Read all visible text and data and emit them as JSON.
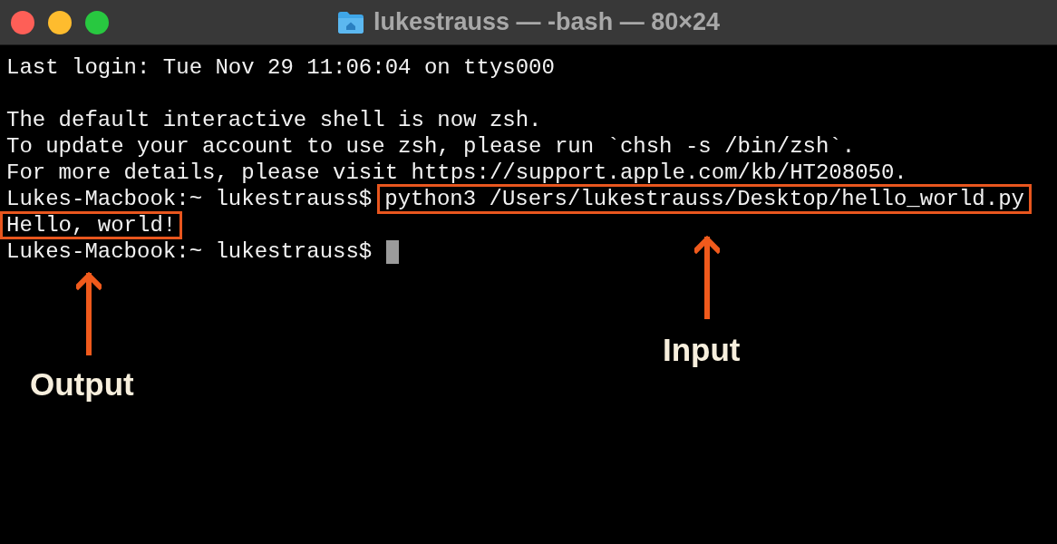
{
  "window": {
    "title": "lukestrauss — -bash — 80×24"
  },
  "terminal": {
    "lines": [
      {
        "kind": "text",
        "text": "Last login: Tue Nov 29 11:06:04 on ttys000"
      },
      {
        "kind": "blank"
      },
      {
        "kind": "text",
        "text": "The default interactive shell is now zsh."
      },
      {
        "kind": "text",
        "text": "To update your account to use zsh, please run `chsh -s /bin/zsh`."
      },
      {
        "kind": "text",
        "text": "For more details, please visit https://support.apple.com/kb/HT208050."
      },
      {
        "kind": "prompt",
        "prompt": "Lukes-Macbook:~ lukestrauss$",
        "command": "python3 /Users/lukestrauss/Desktop/hello_world.py",
        "highlighted": true,
        "cursor": false
      },
      {
        "kind": "output",
        "text": "Hello, world!",
        "highlighted": true
      },
      {
        "kind": "prompt",
        "prompt": "Lukes-Macbook:~ lukestrauss$",
        "cursor": true
      }
    ]
  },
  "annotations": [
    {
      "kind": "output",
      "label": "Output"
    },
    {
      "kind": "input",
      "label": "Input"
    }
  ]
}
